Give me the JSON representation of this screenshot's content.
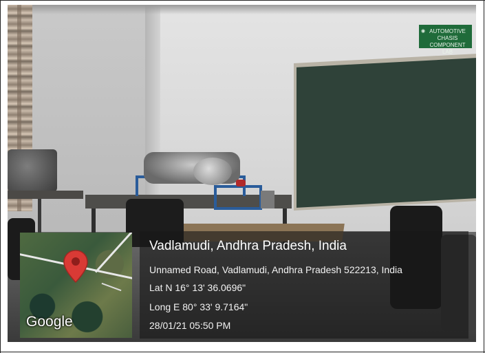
{
  "sign": {
    "text": "AUTOMOTIVE CHASIS COMPONENT LAB"
  },
  "location": {
    "title": "Vadlamudi, Andhra Pradesh, India",
    "address": "Unnamed Road, Vadlamudi, Andhra Pradesh 522213, India",
    "latitude": "Lat N 16° 13' 36.0696\"",
    "longitude": "Long E 80° 33' 9.7164\"",
    "datetime": "28/01/21 05:50 PM"
  },
  "map": {
    "provider_logo": "Google",
    "pin_icon": "map-pin-icon",
    "pin_color": "#d93a35"
  },
  "colors": {
    "overlay": "#181818",
    "board": "#2f4239",
    "sign_bg": "#1f6b3a"
  }
}
